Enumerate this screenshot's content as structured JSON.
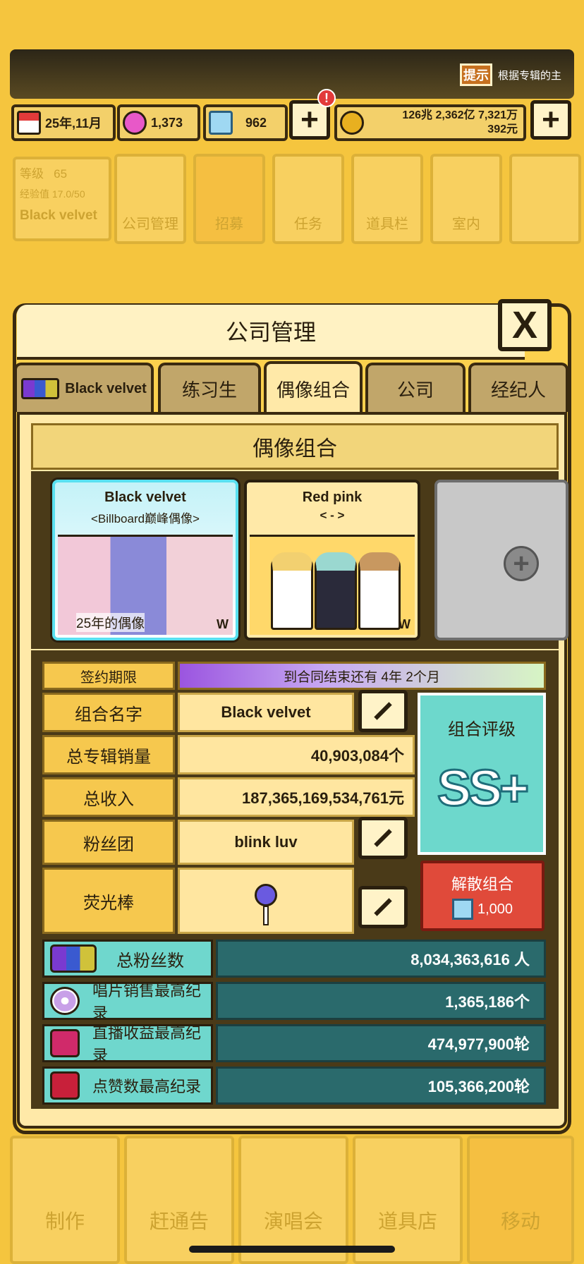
{
  "header": {
    "hint_badge": "提示",
    "hint_text": "根据专辑的主"
  },
  "resources": {
    "date": "25年,11月",
    "pink_gems": "1,373",
    "diamonds": "962",
    "alert": "!",
    "money_line1": "126兆 2,362亿 7,321万",
    "money_line2": "392元",
    "plus": "+"
  },
  "top_menu": {
    "level_label": "等级",
    "level_value": "65",
    "exp_label": "经验值 17.0/50",
    "group_name": "Black velvet",
    "items": [
      "公司管理",
      "招募",
      "任务",
      "道具栏",
      "室内"
    ]
  },
  "bottom_nav": [
    "制作",
    "赶通告",
    "演唱会",
    "道具店",
    "移动"
  ],
  "panel": {
    "title": "公司管理",
    "close": "X"
  },
  "tabs": {
    "group_tab": "Black velvet",
    "trainee": "练习生",
    "idol_group": "偶像组合",
    "company": "公司",
    "agent": "经纪人"
  },
  "section_title": "偶像组合",
  "cards": [
    {
      "name": "Black velvet",
      "subtitle": "<Billboard巅峰偶像>",
      "badge": "25年的偶像",
      "mark": "W"
    },
    {
      "name": "Red pink",
      "subtitle": "< - >",
      "mark": "W"
    },
    {
      "empty": "+"
    }
  ],
  "info": {
    "contract_label": "签约期限",
    "contract_text": "到合同结束还有 4年 2个月",
    "name_label": "组合名字",
    "name_value": "Black velvet",
    "sales_label": "总专辑销量",
    "sales_value": "40,903,084个",
    "income_label": "总收入",
    "income_value": "187,365,169,534,761元",
    "fandom_label": "粉丝团",
    "fandom_value": "blink luv",
    "lightstick_label": "荧光棒",
    "rating_label": "组合评级",
    "rating_value": "SS+",
    "disband_label": "解散组合",
    "disband_cost": "1,000"
  },
  "stats": [
    {
      "label": "总粉丝数",
      "value": "8,034,363,616 人",
      "icon": "fans-icon"
    },
    {
      "label": "唱片销售最高纪录",
      "value": "1,365,186个",
      "icon": "disc-icon"
    },
    {
      "label": "直播收益最高纪录",
      "value": "474,977,900轮",
      "icon": "music-icon"
    },
    {
      "label": "点赞数最高纪录",
      "value": "105,366,200轮",
      "icon": "play-icon"
    }
  ],
  "colors": {
    "background": "#f5c53e",
    "panel": "#fcd14e",
    "teal": "#6fd7cd",
    "dark_teal": "#2a6a6c",
    "red": "#e04a3a"
  }
}
